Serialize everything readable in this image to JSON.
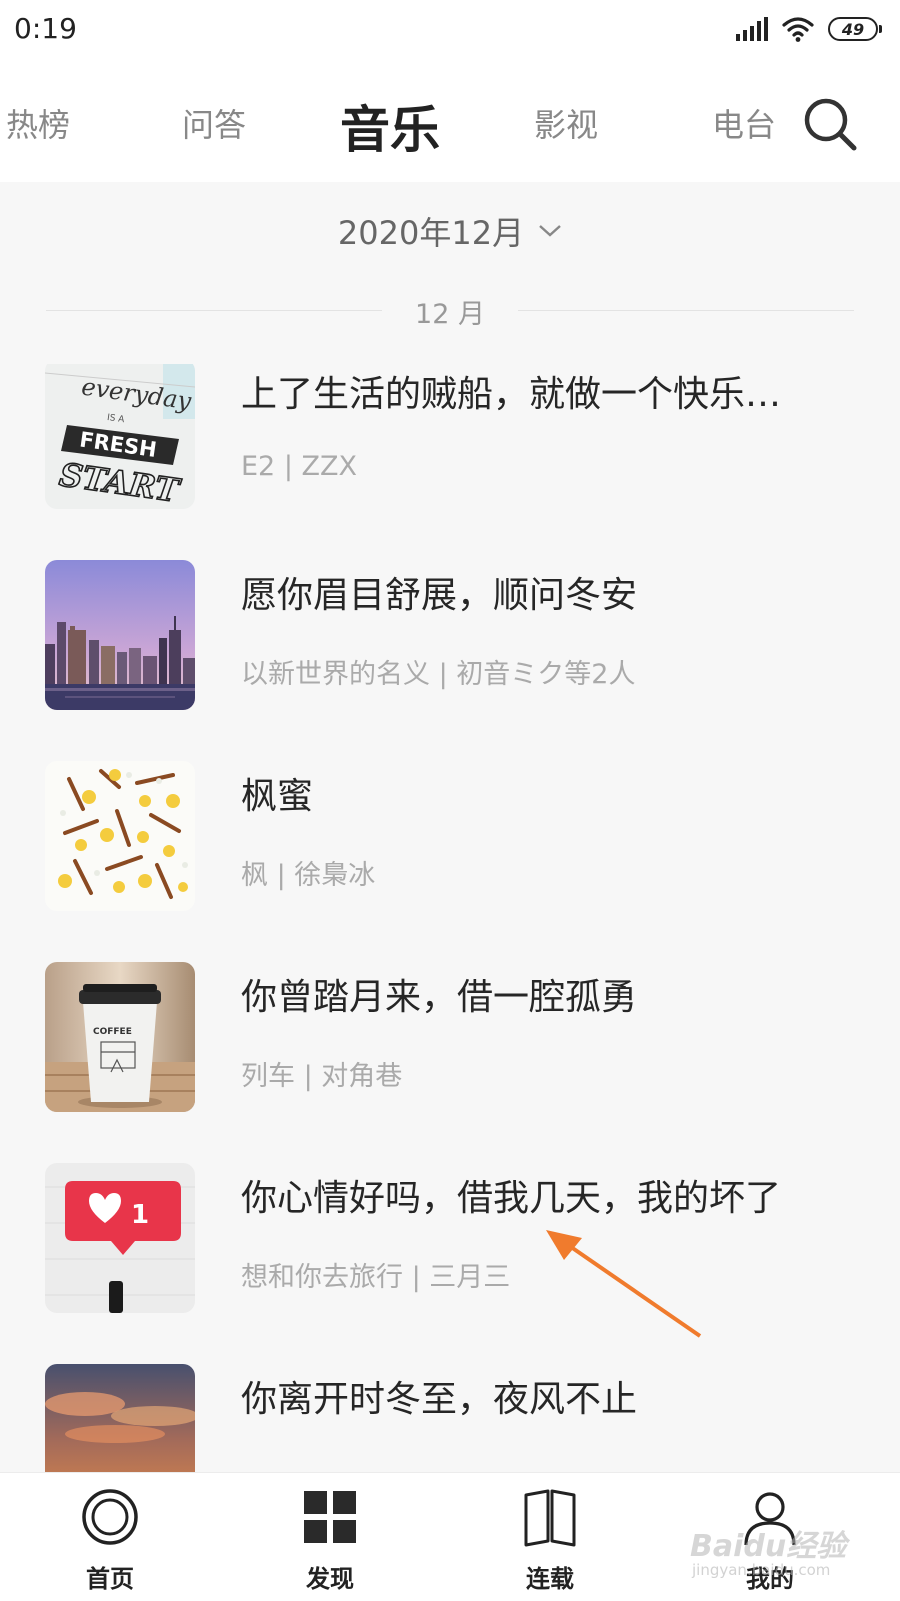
{
  "status_bar": {
    "time": "0:19",
    "battery": "49"
  },
  "top_tabs": [
    {
      "label": "热榜",
      "active": false
    },
    {
      "label": "问答",
      "active": false
    },
    {
      "label": "音乐",
      "active": true
    },
    {
      "label": "影视",
      "active": false
    },
    {
      "label": "电台",
      "active": false
    }
  ],
  "date_filter": {
    "selected": "2020年12月"
  },
  "month_header": "12 月",
  "songs": [
    {
      "title": "上了生活的贼船，就做一个快乐…",
      "meta": "E2 | ZZX",
      "cover": "everyday-fresh-start-cover"
    },
    {
      "title": "愿你眉目舒展，顺问冬安",
      "meta": "以新世界的名义 | 初音ミク等2人",
      "cover": "city-skyline-cover"
    },
    {
      "title": "枫蜜",
      "meta": "枫 | 徐梟冰",
      "cover": "cinnamon-lemon-cover"
    },
    {
      "title": "你曾踏月来，借一腔孤勇",
      "meta": "列车 | 对角巷",
      "cover": "coffee-cup-cover"
    },
    {
      "title": "你心情好吗，借我几天，我的坏了",
      "meta": "想和你去旅行 | 三月三",
      "cover": "heart-notification-cover"
    },
    {
      "title": "你离开时冬至，夜风不止",
      "meta": "",
      "cover": "sunset-clouds-cover"
    }
  ],
  "cover_texts": {
    "cover1": [
      "everyday",
      "IS A",
      "FRESH",
      "START"
    ],
    "cover4": "COFFEE",
    "cover5": "1"
  },
  "bottom_nav": [
    {
      "label": "首页",
      "icon": "home-ring-icon"
    },
    {
      "label": "发现",
      "icon": "grid-icon"
    },
    {
      "label": "连载",
      "icon": "book-icon"
    },
    {
      "label": "我的",
      "icon": "user-icon"
    }
  ],
  "watermark": {
    "brand": "Baidu经验",
    "url": "jingyan.baidu.com"
  },
  "colors": {
    "annotation_arrow": "#f07b2d",
    "meta_text": "#aaaaaa"
  }
}
